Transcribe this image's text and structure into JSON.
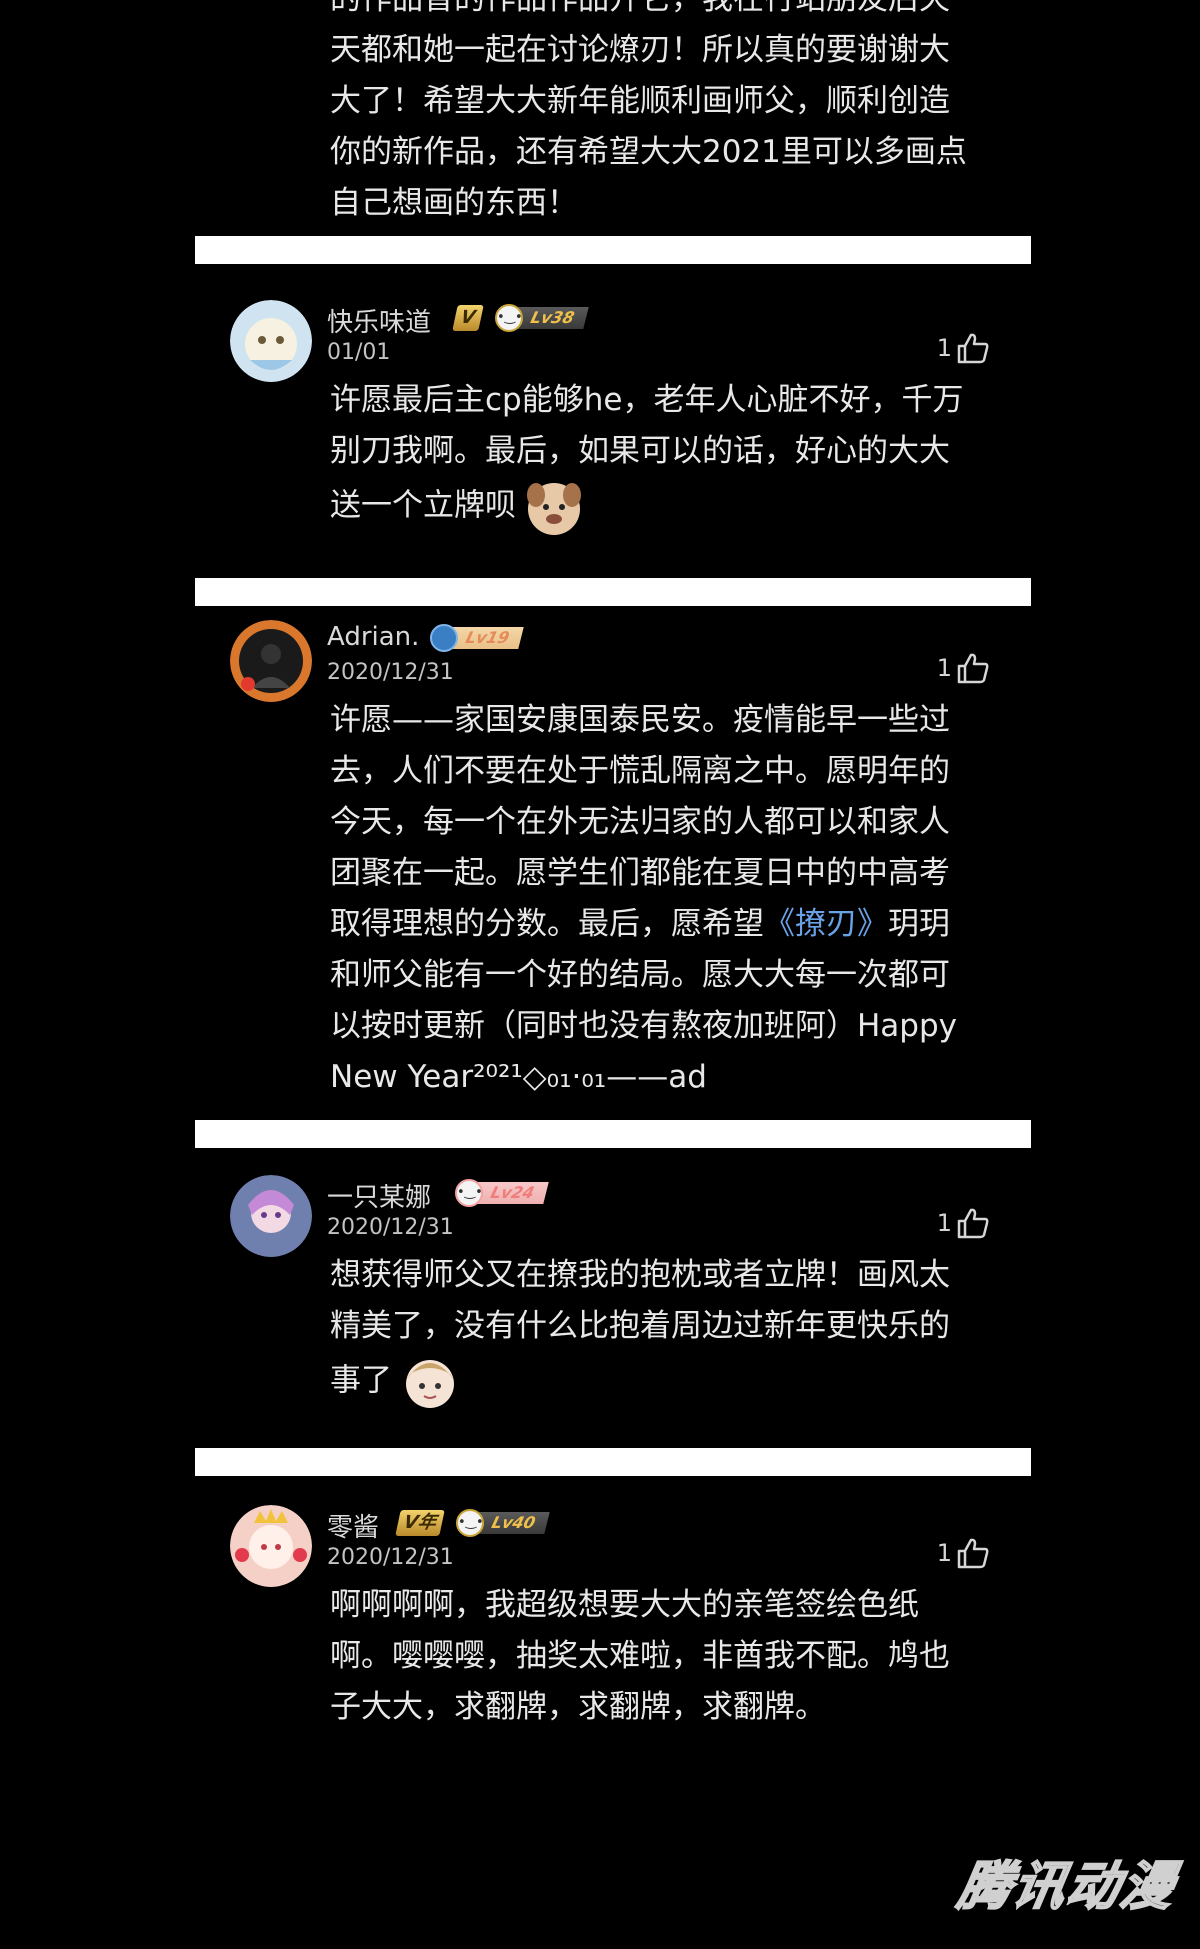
{
  "previous_comment": {
    "lines": [
      "的作品曾的作品作品开它，我在行站朋友后天",
      "天都和她一起在讨论燎刃！所以真的要谢谢大",
      "大了！希望大大新年能顺利画师父，顺利创造",
      "你的新作品，还有希望大大2021里可以多画点",
      "自己想画的东西！"
    ]
  },
  "comments": [
    {
      "username": "快乐味道",
      "vip_label": "V",
      "level": "Lv38",
      "date": "01/01",
      "likes": "1",
      "lines": [
        "许愿最后主cp能够he，老年人心脏不好，千万",
        "别刀我啊。最后，如果可以的话，好心的大大",
        "送一个立牌呗"
      ],
      "sticker": "dog-sticker"
    },
    {
      "username": "Adrian.",
      "level": "Lv19",
      "date": "2020/12/31",
      "likes": "1",
      "lines": [
        "许愿——家国安康国泰民安。疫情能早一些过",
        "去，人们不要在处于慌乱隔离之中。愿明年的",
        "今天，每一个在外无法归家的人都可以和家人",
        "团聚在一起。愿学生们都能在夏日中的中高考"
      ],
      "line5_before": "取得理想的分数。最后，愿希望",
      "line5_link": "《撩刃》",
      "line5_after": "玥玥",
      "lines_tail": [
        "和师父能有一个好的结局。愿大大每一次都可",
        "以按时更新（同时也没有熬夜加班阿）Happy",
        "New Year²⁰²¹◇₀₁·₀₁——ad"
      ]
    },
    {
      "username": "一只某娜",
      "level": "Lv24",
      "date": "2020/12/31",
      "likes": "1",
      "lines": [
        "想获得师父又在撩我的抱枕或者立牌！画风太",
        "精美了，没有什么比抱着周边过新年更快乐的",
        "事了"
      ],
      "sticker": "girl-sticker"
    },
    {
      "username": "零酱",
      "vip_label": "V年",
      "level": "Lv40",
      "date": "2020/12/31",
      "likes": "1",
      "lines": [
        "啊啊啊啊，我超级想要大大的亲笔签绘色纸",
        "啊。嘤嘤嘤，抽奖太难啦，非酋我不配。鸠也",
        "子大大，求翻牌，求翻牌，求翻牌。"
      ]
    }
  ],
  "watermark": "腾讯动漫",
  "colors": {
    "background": "#000000",
    "divider": "#ffffff",
    "link": "#6aa2e6",
    "vip_gold": "#f3d36c"
  }
}
